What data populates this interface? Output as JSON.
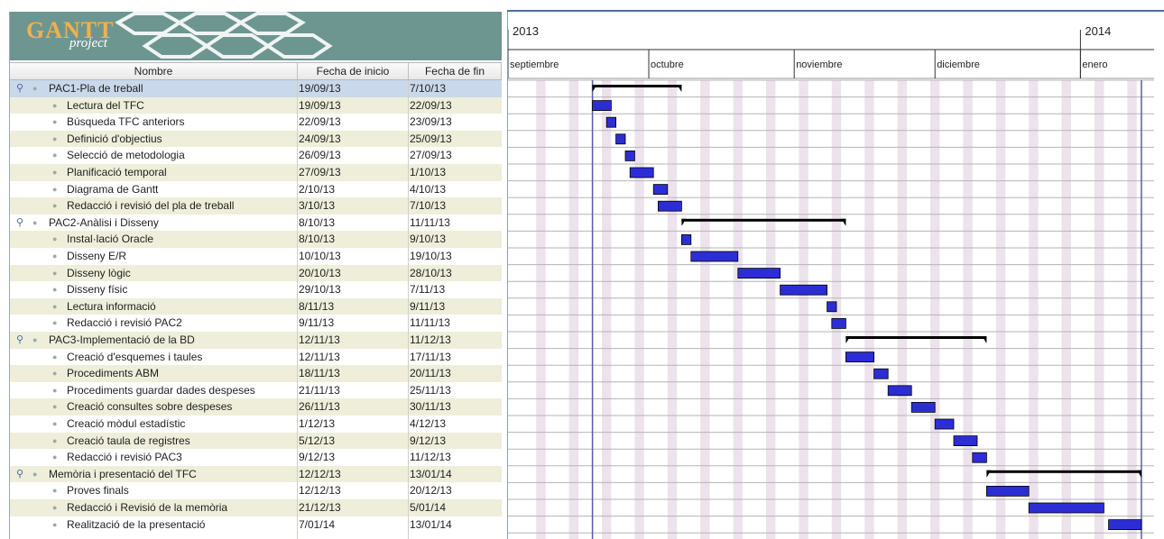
{
  "app": {
    "logo_main": "GANTT",
    "logo_sub": "project"
  },
  "table": {
    "columns": {
      "name": "Nombre",
      "start": "Fecha de inicio",
      "end": "Fecha de fin"
    },
    "rows": [
      {
        "name": "PAC1-Pla de treball",
        "start": "19/09/13",
        "end": "7/10/13",
        "group": true,
        "selected": true
      },
      {
        "name": "Lectura del TFC",
        "start": "19/09/13",
        "end": "22/09/13"
      },
      {
        "name": "Búsqueda TFC anteriors",
        "start": "22/09/13",
        "end": "23/09/13"
      },
      {
        "name": "Definició d'objectius",
        "start": "24/09/13",
        "end": "25/09/13"
      },
      {
        "name": "Selecció de metodologia",
        "start": "26/09/13",
        "end": "27/09/13"
      },
      {
        "name": "Planificació temporal",
        "start": "27/09/13",
        "end": "1/10/13"
      },
      {
        "name": "Diagrama de Gantt",
        "start": "2/10/13",
        "end": "4/10/13"
      },
      {
        "name": "Redacció i revisió del pla de treball",
        "start": "3/10/13",
        "end": "7/10/13"
      },
      {
        "name": "PAC2-Anàlisi i Disseny",
        "start": "8/10/13",
        "end": "11/11/13",
        "group": true
      },
      {
        "name": "Instal·lació Oracle",
        "start": "8/10/13",
        "end": "9/10/13"
      },
      {
        "name": "Disseny E/R",
        "start": "10/10/13",
        "end": "19/10/13"
      },
      {
        "name": "Disseny lògic",
        "start": "20/10/13",
        "end": "28/10/13"
      },
      {
        "name": "Disseny físic",
        "start": "29/10/13",
        "end": "7/11/13"
      },
      {
        "name": "Lectura informació",
        "start": "8/11/13",
        "end": "9/11/13"
      },
      {
        "name": "Redacció i revisió PAC2",
        "start": "9/11/13",
        "end": "11/11/13"
      },
      {
        "name": "PAC3-Implementació de la BD",
        "start": "12/11/13",
        "end": "11/12/13",
        "group": true
      },
      {
        "name": "Creació d'esquemes i taules",
        "start": "12/11/13",
        "end": "17/11/13"
      },
      {
        "name": "Procediments ABM",
        "start": "18/11/13",
        "end": "20/11/13"
      },
      {
        "name": "Procediments guardar dades despeses",
        "start": "21/11/13",
        "end": "25/11/13"
      },
      {
        "name": "Creació consultes sobre despeses",
        "start": "26/11/13",
        "end": "30/11/13"
      },
      {
        "name": "Creació mòdul estadístic",
        "start": "1/12/13",
        "end": "4/12/13"
      },
      {
        "name": "Creació taula de registres",
        "start": "5/12/13",
        "end": "9/12/13"
      },
      {
        "name": "Redacció i revisió PAC3",
        "start": "9/12/13",
        "end": "11/12/13"
      },
      {
        "name": "Memòria i presentació del TFC",
        "start": "12/12/13",
        "end": "13/01/14",
        "group": true
      },
      {
        "name": "Proves finals",
        "start": "12/12/13",
        "end": "20/12/13"
      },
      {
        "name": "Redacció i Revisió de la memòria",
        "start": "21/12/13",
        "end": "5/01/14"
      },
      {
        "name": "Realització de la presentació",
        "start": "7/01/14",
        "end": "13/01/14"
      }
    ]
  },
  "timeline": {
    "years": [
      "2013",
      "2014"
    ],
    "months": [
      "septiembre",
      "octubre",
      "noviembre",
      "diciembre",
      "enero"
    ]
  },
  "colors": {
    "task_bar": "#2d2dd6",
    "group_bar": "#000000",
    "logo_bg": "#6e9690",
    "odd_row": "#eeeeda",
    "selected_row": "#c9d8ea",
    "weekend_stripe": "#ece3ec"
  }
}
